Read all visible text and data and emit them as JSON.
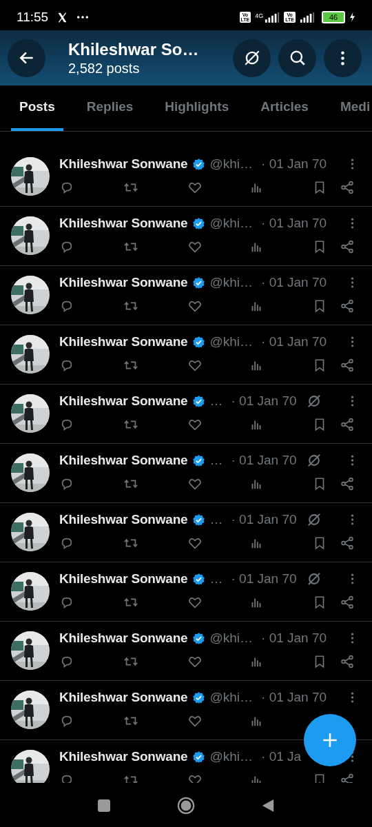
{
  "status_bar": {
    "time": "11:55",
    "sims": [
      {
        "badge_top": "Vo",
        "badge_bottom": "LTE",
        "network": "4G"
      },
      {
        "badge_top": "Vo",
        "badge_bottom": "LTE"
      }
    ],
    "battery": "46"
  },
  "header": {
    "title": "Khileshwar So…",
    "subtitle": "2,582 posts"
  },
  "tabs": [
    {
      "label": "Posts",
      "selected": true
    },
    {
      "label": "Replies",
      "selected": false
    },
    {
      "label": "Highlights",
      "selected": false
    },
    {
      "label": "Articles",
      "selected": false
    },
    {
      "label": "Medi",
      "selected": false
    }
  ],
  "posts": [
    {
      "kind": "plain",
      "name": "Khileshwar Sonwane",
      "handle": "@khi…",
      "date": "· 01 Jan 70",
      "trailing_actions": true
    },
    {
      "kind": "plain",
      "name": "Khileshwar Sonwane",
      "handle": "@khi…",
      "date": "· 01 Jan 70",
      "trailing_actions": true
    },
    {
      "kind": "plain",
      "name": "Khileshwar Sonwane",
      "handle": "@khi…",
      "date": "· 01 Jan 70",
      "trailing_actions": true
    },
    {
      "kind": "plain",
      "name": "Khileshwar Sonwane",
      "handle": "@khi…",
      "date": "· 01 Jan 70",
      "trailing_actions": true
    },
    {
      "kind": "slashed",
      "name": "Khileshwar Sonwane",
      "handle": "…",
      "date": "· 01 Jan 70",
      "trailing_actions": true
    },
    {
      "kind": "slashed",
      "name": "Khileshwar Sonwane",
      "handle": "…",
      "date": "· 01 Jan 70",
      "trailing_actions": true
    },
    {
      "kind": "slashed",
      "name": "Khileshwar Sonwane",
      "handle": "…",
      "date": "· 01 Jan 70",
      "trailing_actions": true
    },
    {
      "kind": "slashed",
      "name": "Khileshwar Sonwane",
      "handle": "…",
      "date": "· 01 Jan 70",
      "trailing_actions": true
    },
    {
      "kind": "plain",
      "name": "Khileshwar Sonwane",
      "handle": "@khi…",
      "date": "· 01 Jan 70",
      "trailing_actions": true
    },
    {
      "kind": "plain",
      "name": "Khileshwar Sonwane",
      "handle": "@khi…",
      "date": "· 01 Jan 70",
      "trailing_actions": false
    },
    {
      "kind": "plain",
      "name": "Khileshwar Sonwane",
      "handle": "@khi…",
      "date": "· 01 Ja",
      "trailing_actions": true
    }
  ]
}
